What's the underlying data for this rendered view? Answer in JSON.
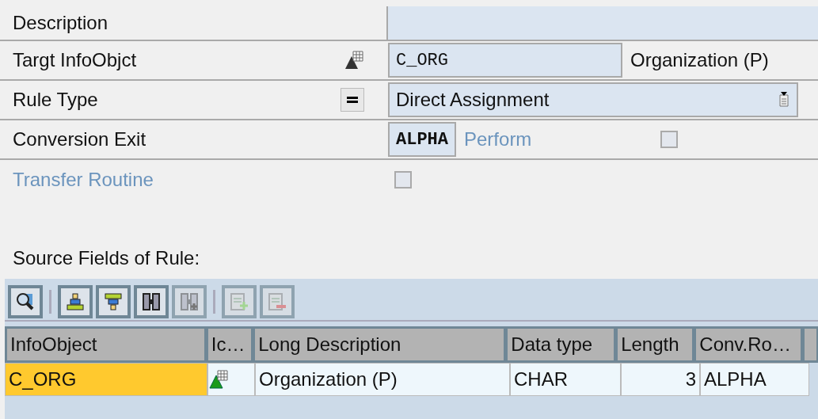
{
  "form": {
    "description": {
      "label": "Description"
    },
    "target": {
      "label": "Targt InfoObjct",
      "value": "C_ORG",
      "text": "Organization (P)"
    },
    "rule_type": {
      "label": "Rule Type",
      "value": "Direct Assignment"
    },
    "conversion": {
      "label": "Conversion Exit",
      "value": "ALPHA",
      "option": {
        "label": "Perform",
        "checked": false,
        "disabled": true
      }
    },
    "transfer_routine": {
      "label": "Transfer Routine",
      "checked": false,
      "disabled": true
    }
  },
  "source_fields": {
    "title": "Source Fields of Rule:",
    "toolbar": [
      {
        "kind": "details",
        "disabled": false
      },
      {
        "kind": "separator"
      },
      {
        "kind": "sort-up",
        "disabled": false
      },
      {
        "kind": "sort-down",
        "disabled": false
      },
      {
        "kind": "find",
        "disabled": false
      },
      {
        "kind": "find-next",
        "disabled": true
      },
      {
        "kind": "separator"
      },
      {
        "kind": "insert",
        "disabled": true
      },
      {
        "kind": "delete",
        "disabled": true
      }
    ],
    "columns": [
      "InfoObject",
      "Ic…",
      "Long Description",
      "Data type",
      "Length",
      "Conv.Ro…"
    ],
    "rows": [
      {
        "selected": true,
        "infoobject": "C_ORG",
        "long_description": "Organization (P)",
        "data_type": "CHAR",
        "length": "3",
        "conv_routine": "ALPHA"
      }
    ]
  }
}
